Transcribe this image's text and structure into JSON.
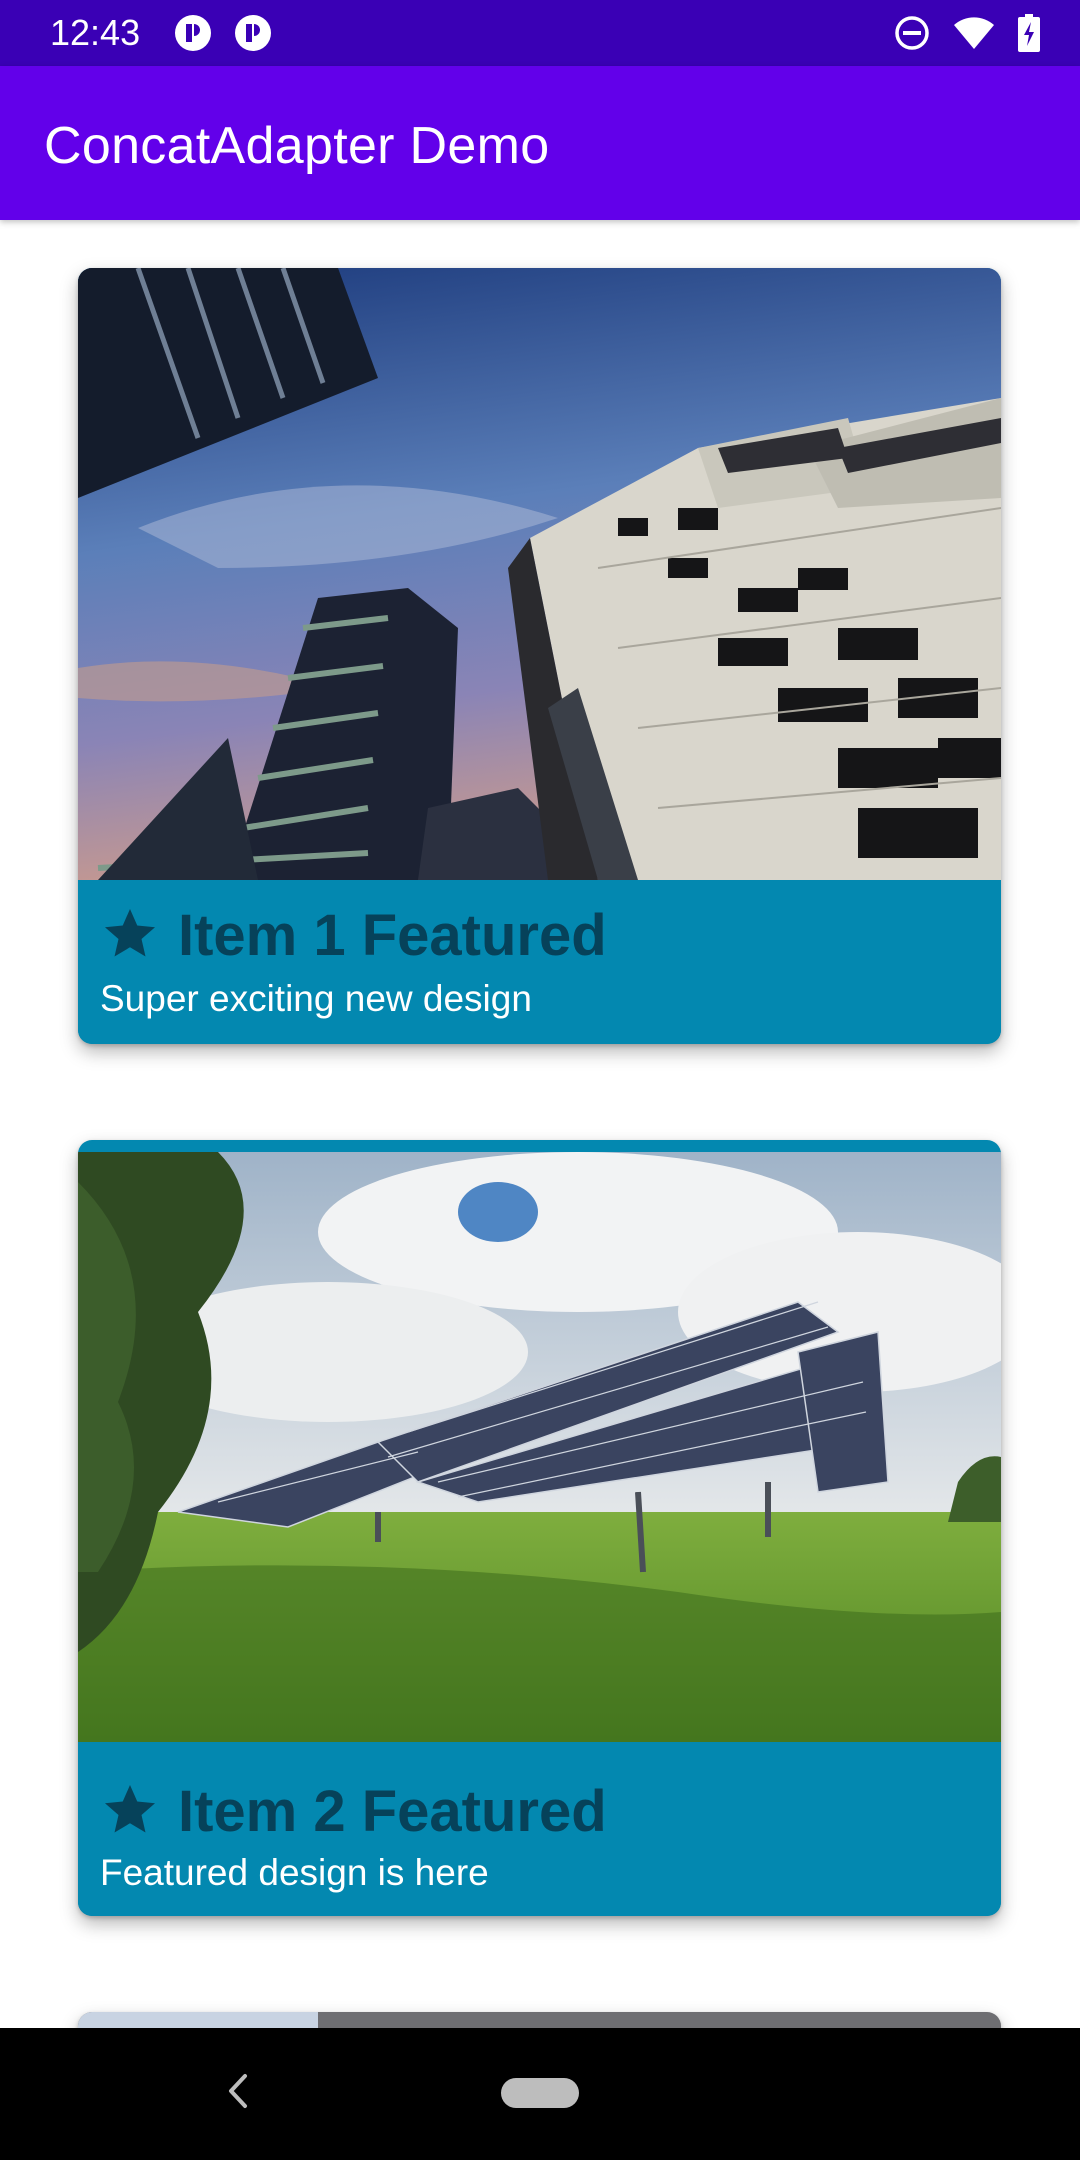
{
  "status_bar": {
    "time": "12:43",
    "notification_icons": [
      "app-notification-icon",
      "app-notification-icon"
    ],
    "right_icons": [
      "do-not-disturb-icon",
      "wifi-icon",
      "battery-charging-icon"
    ]
  },
  "app_bar": {
    "title": "ConcatAdapter Demo"
  },
  "cards": [
    {
      "title": "Item 1 Featured",
      "subtitle": "Super exciting new design",
      "icon": "star-icon",
      "image": "buildings-photo"
    },
    {
      "title": "Item 2 Featured",
      "subtitle": "Featured design is here",
      "icon": "star-icon",
      "image": "solar-panels-photo"
    }
  ],
  "nav_bar": {
    "icons": [
      "back-icon",
      "home-pill-icon"
    ]
  },
  "colors": {
    "status_bar": "#3a00b5",
    "app_bar": "#6200ea",
    "card_footer": "#0388b0",
    "card_title": "#06425a"
  }
}
